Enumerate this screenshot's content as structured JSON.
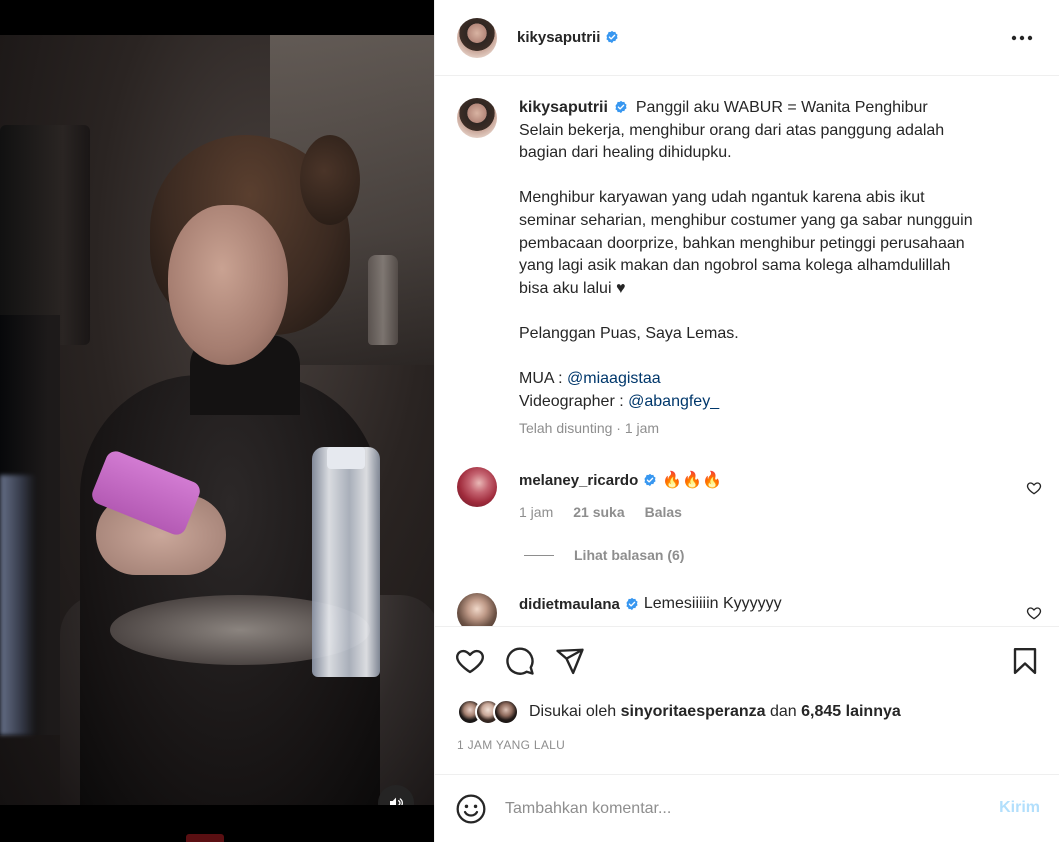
{
  "post": {
    "username": "kikysaputrii",
    "caption_lines": [
      "Panggil aku WABUR = Wanita Penghibur",
      "Selain bekerja, menghibur orang dari atas panggung adalah",
      "bagian dari healing dihidupku.",
      "",
      "Menghibur karyawan yang udah ngantuk karena abis ikut",
      "seminar seharian, menghibur costumer yang ga sabar nungguin",
      "pembacaan doorprize, bahkan menghibur petinggi perusahaan",
      "yang lagi asik makan dan ngobrol sama kolega alhamdulillah",
      "bisa aku lalui ♥",
      "",
      "Pelanggan Puas, Saya Lemas.",
      "",
      "MUA : ",
      "Videographer : "
    ],
    "mua_mention": "@miaagistaa",
    "videographer_mention": "@abangfey_",
    "meta": "Telah disunting · 1 jam"
  },
  "comments": [
    {
      "username": "melaney_ricardo",
      "text": "🔥🔥🔥",
      "time": "1 jam",
      "likes": "21 suka",
      "reply_label": "Balas",
      "view_replies": "Lihat balasan (6)"
    },
    {
      "username": "didietmaulana",
      "text": "Lemesiiiiin Kyyyyyy"
    }
  ],
  "likes": {
    "prefix": "Disukai oleh ",
    "user": "sinyoritaesperanza",
    "middle": " dan ",
    "count": "6,845 lainnya"
  },
  "time_ago": "1 JAM YANG LALU",
  "comment_box": {
    "placeholder": "Tambahkan komentar...",
    "post_label": "Kirim"
  },
  "colors": {
    "verified": "#3897f0",
    "link": "#00376b",
    "muted": "#8e8e8e",
    "post_disabled": "#b2dffc"
  },
  "icons": [
    "verified-badge-icon",
    "more-options-icon",
    "heart-icon",
    "comment-icon",
    "share-icon",
    "bookmark-icon",
    "emoji-icon",
    "speaker-icon"
  ]
}
